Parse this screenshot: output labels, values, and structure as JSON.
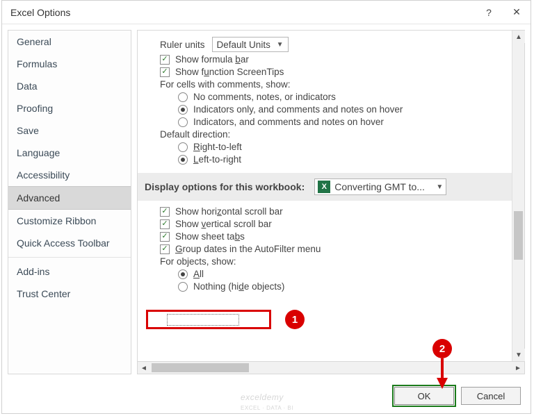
{
  "title": "Excel Options",
  "help_icon": "?",
  "close_icon": "✕",
  "sidebar": {
    "items": [
      {
        "label": "General"
      },
      {
        "label": "Formulas"
      },
      {
        "label": "Data"
      },
      {
        "label": "Proofing"
      },
      {
        "label": "Save"
      },
      {
        "label": "Language"
      },
      {
        "label": "Accessibility"
      },
      {
        "label": "Advanced",
        "selected": true
      },
      {
        "label": "Customize Ribbon"
      },
      {
        "label": "Quick Access Toolbar"
      },
      {
        "label": "Add-ins"
      },
      {
        "label": "Trust Center"
      }
    ]
  },
  "content": {
    "ruler_label": "Ruler units",
    "ruler_value": "Default Units",
    "show_formula_bar": "Show formula bar",
    "show_function_screentips": "Show function ScreenTips",
    "comments_heading": "For cells with comments, show:",
    "comments_opt1": "No comments, notes, or indicators",
    "comments_opt2": "Indicators only, and comments and notes on hover",
    "comments_opt3": "Indicators, and comments and notes on hover",
    "direction_heading": "Default direction:",
    "direction_rtl": "Right-to-left",
    "direction_ltr": "Left-to-right",
    "section_workbook": "Display options for this workbook:",
    "workbook_name": "Converting GMT to...",
    "show_hscroll": "Show horizontal scroll bar",
    "show_vscroll": "Show vertical scroll bar",
    "show_sheet_tabs": "Show sheet tabs",
    "group_dates": "Group dates in the AutoFilter menu",
    "objects_heading": "For objects, show:",
    "objects_all": "All",
    "objects_nothing": "Nothing (hide objects)"
  },
  "footer": {
    "ok": "OK",
    "cancel": "Cancel"
  },
  "callouts": {
    "n1": "1",
    "n2": "2"
  },
  "watermark": "exceldemy"
}
